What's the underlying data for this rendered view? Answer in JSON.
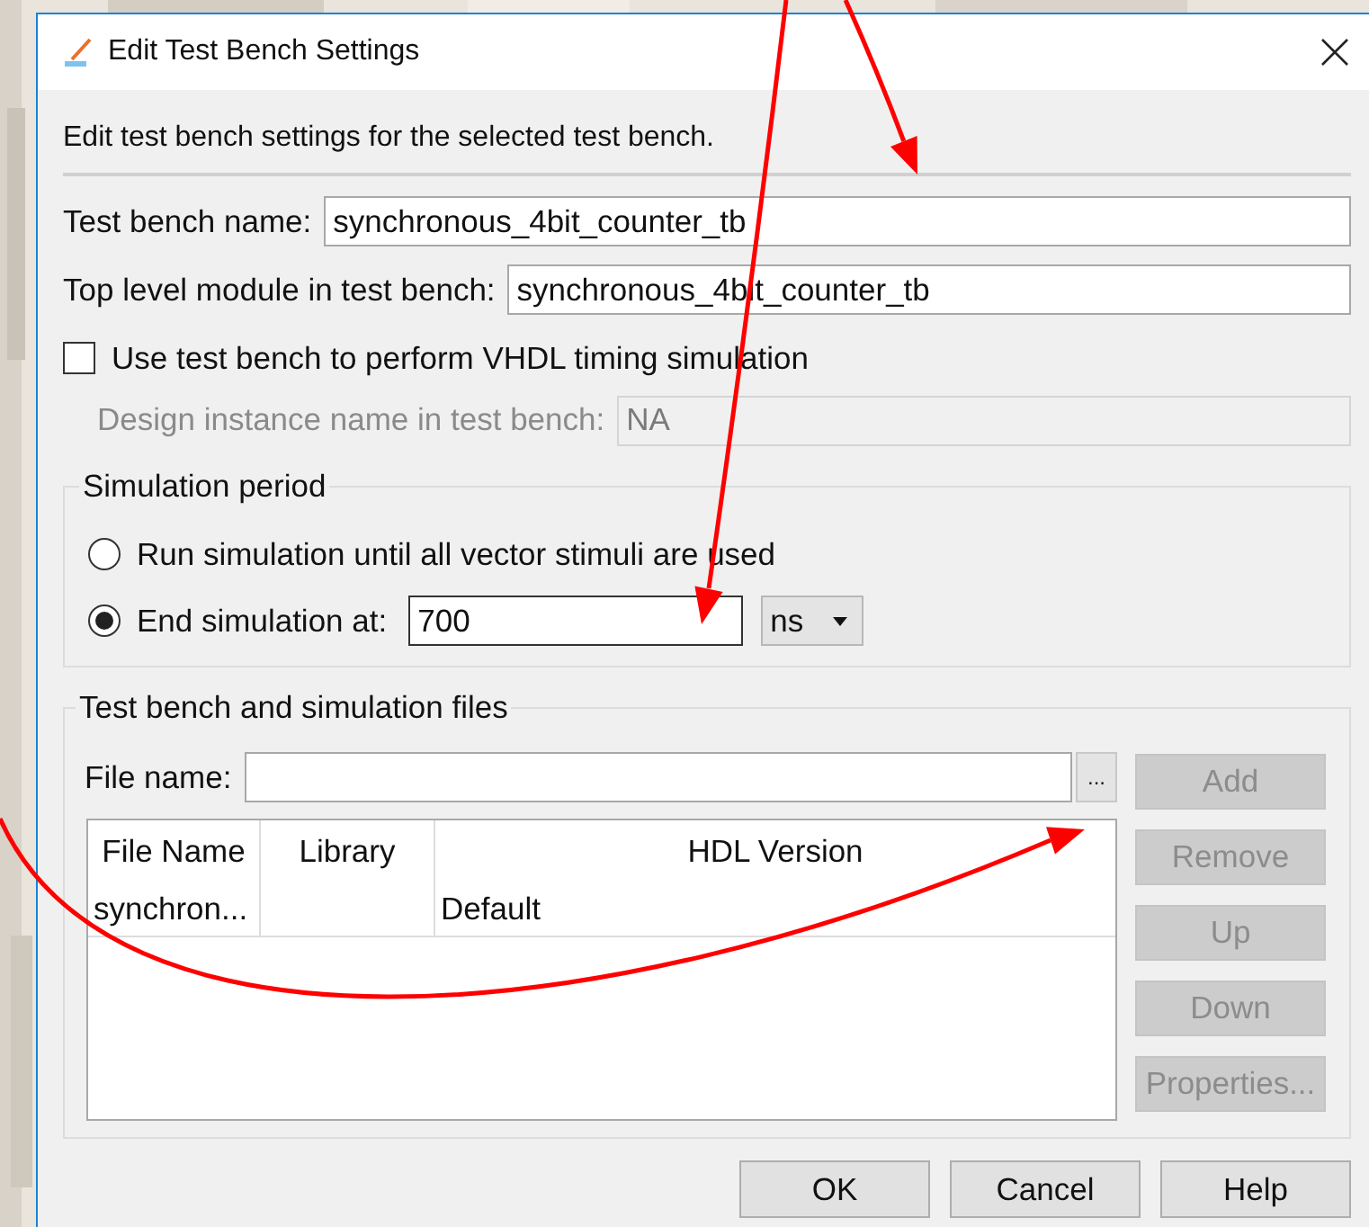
{
  "window": {
    "title": "Edit Test Bench Settings"
  },
  "description": "Edit test bench settings for the selected test bench.",
  "fields": [
    {
      "label": "Test bench name:",
      "value": "synchronous_4bit_counter_tb"
    },
    {
      "label": "Top level module in test bench:",
      "value": "synchronous_4bit_counter_tb"
    }
  ],
  "vhdl_timing": {
    "label": "Use test bench to perform VHDL timing simulation",
    "checked": false
  },
  "design_instance": {
    "label": "Design instance name in test bench:",
    "value": "NA",
    "disabled": true
  },
  "simulation_period": {
    "title": "Simulation period",
    "options": [
      {
        "kind": "plain",
        "label": "Run simulation until all vector stimuli are used",
        "selected": false
      },
      {
        "kind": "time",
        "label": "End simulation at:",
        "selected": true
      }
    ],
    "end_time": "700",
    "unit": "ns"
  },
  "files": {
    "title": "Test bench and simulation files",
    "file_name_label": "File name:",
    "browse_button": "...",
    "columns": [
      "File Name",
      "Library",
      "HDL Version"
    ],
    "rows": [
      {
        "file_name": "synchron...",
        "hdl_version": "Default"
      }
    ],
    "buttons": [
      {
        "label": "Add",
        "disabled": true
      },
      {
        "label": "Remove",
        "disabled": true
      },
      {
        "label": "Up",
        "disabled": true
      },
      {
        "label": "Down",
        "disabled": true
      },
      {
        "label": "Properties...",
        "disabled": true
      }
    ]
  },
  "buttons": [
    "OK",
    "Cancel",
    "Help"
  ]
}
